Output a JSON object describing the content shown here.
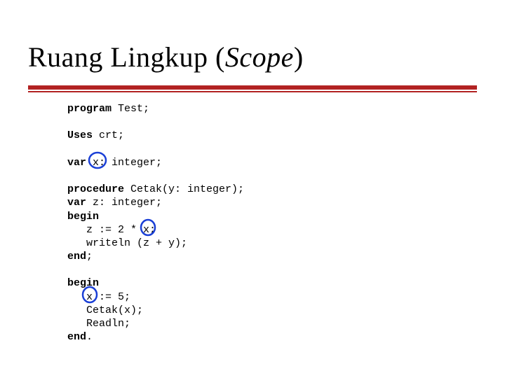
{
  "title": {
    "plain": "Ruang Lingkup (",
    "italic": "Scope",
    "close": ")"
  },
  "circle_color": "#1a3fd6",
  "code": {
    "l1_kw": "program",
    "l1_rest": " Test;",
    "l2_kw": "Uses",
    "l2_rest": " crt;",
    "l3_kw": "var",
    "l3_sp": " ",
    "l3_var": "x:",
    "l3_rest": " integer;",
    "l4_kw": "procedure",
    "l4_rest": " Cetak(y: integer);",
    "l5_kw": "var",
    "l5_rest": " z: integer;",
    "l6_kw": "begin",
    "l7_a": "   z := 2 * ",
    "l7_var": "x;",
    "l8": "   writeln (z + y);",
    "l9_kw": "end",
    "l9_rest": ";",
    "l10_kw": "begin",
    "l11_a": "   ",
    "l11_var": "x",
    "l11_b": " := 5;",
    "l12": "   Cetak(x);",
    "l13": "   Readln;",
    "l14_kw": "end",
    "l14_rest": "."
  }
}
